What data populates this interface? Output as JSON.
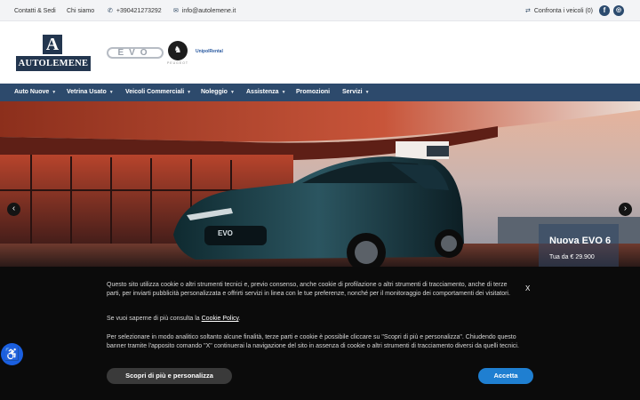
{
  "topbar": {
    "contacts": "Contatti & Sedi",
    "about": "Chi siamo",
    "phone": "+390421273292",
    "email": "info@autolemene.it",
    "compare": "Confronta i veicoli (0)",
    "social": [
      "facebook-icon",
      "instagram-icon"
    ]
  },
  "header": {
    "logo_letter": "A",
    "logo_text": "AUTOLEMENE",
    "evo_logo": "EVO",
    "peugeot_logo": "♞",
    "peugeot_sub": "PEUGEOT",
    "third_brand": "UnipolRental"
  },
  "nav": {
    "items": [
      {
        "label": "Auto Nuove",
        "dropdown": true
      },
      {
        "label": "Vetrina Usato",
        "dropdown": true
      },
      {
        "label": "Veicoli Commerciali",
        "dropdown": true
      },
      {
        "label": "Noleggio",
        "dropdown": true
      },
      {
        "label": "Assistenza",
        "dropdown": true
      },
      {
        "label": "Promozioni",
        "dropdown": false
      },
      {
        "label": "Servizi",
        "dropdown": true
      }
    ]
  },
  "hero": {
    "slide_title": "Nuova EVO 6",
    "slide_price": "Tua da € 29.900",
    "car_plate": "EVO",
    "prev_icon": "chevron-left-icon",
    "next_icon": "chevron-right-icon"
  },
  "cookie": {
    "paragraph1": "Questo sito utilizza cookie o altri strumenti tecnici e, previo consenso, anche cookie di profilazione o altri strumenti di tracciamento, anche di terze parti, per inviarti pubblicità personalizzata e offrirti servizi in linea con le tue preferenze, nonché per il monitoraggio dei comportamenti dei visitatori.",
    "paragraph2_prefix": "Se vuoi saperne di più consulta la ",
    "policy_link": "Cookie Policy",
    "paragraph2_suffix": ".",
    "paragraph3": "Per selezionare in modo analitico soltanto alcune finalità, terze parti e cookie è possibile cliccare su \"Scopri di più e personalizza\". Chiudendo questo banner tramite l'apposito comando \"X\" continuerai la navigazione del sito in assenza di cookie o altri strumenti di tracciamento diversi da quelli tecnici.",
    "close_label": "X",
    "more_button": "Scopri di più e personalizza",
    "accept_button": "Accetta"
  },
  "colors": {
    "nav_bg": "#2d4a6c",
    "accept": "#1f7fd1",
    "accessibility": "#1a5fe0"
  }
}
